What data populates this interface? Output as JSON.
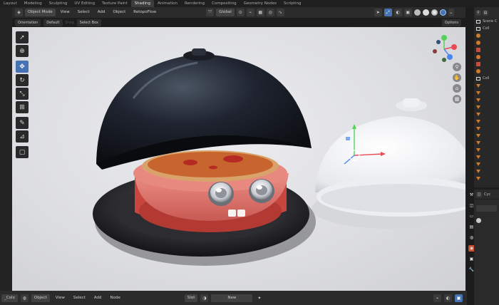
{
  "workspace_tabs": [
    {
      "label": "Layout",
      "active": false
    },
    {
      "label": "Modeling",
      "active": false
    },
    {
      "label": "Sculpting",
      "active": false
    },
    {
      "label": "UV Editing",
      "active": false
    },
    {
      "label": "Texture Paint",
      "active": false
    },
    {
      "label": "Shading",
      "active": true
    },
    {
      "label": "Animation",
      "active": false
    },
    {
      "label": "Rendering",
      "active": false
    },
    {
      "label": "Compositing",
      "active": false
    },
    {
      "label": "Geometry Nodes",
      "active": false
    },
    {
      "label": "Scripting",
      "active": false
    }
  ],
  "viewport_header": {
    "mode": "Object Mode",
    "menus": [
      "View",
      "Select",
      "Add",
      "Object"
    ],
    "addon": "RetopoFlow",
    "orientation": "Global",
    "icons": [
      "editor-type-icon",
      "transform-pivot-icon",
      "snap-icon",
      "proportional-icon"
    ]
  },
  "tool_settings": {
    "orientation_label": "Orientation",
    "orientation_value": "Default",
    "drag_label": "Drag",
    "drag_value": "Select Box",
    "options": "Options"
  },
  "toolbar": [
    {
      "icon": "select-cursor-icon",
      "active": false
    },
    {
      "icon": "cursor-3d-icon",
      "active": false
    },
    {
      "icon": "move-icon",
      "active": true
    },
    {
      "icon": "rotate-icon",
      "active": false
    },
    {
      "icon": "scale-icon",
      "active": false
    },
    {
      "icon": "transform-icon",
      "active": false
    },
    {
      "icon": "annotate-icon",
      "active": false
    },
    {
      "icon": "measure-icon",
      "active": false
    },
    {
      "icon": "add-cube-icon",
      "active": false
    }
  ],
  "outliner": {
    "header": "Scene C",
    "collection_1": "Coll",
    "collection_2": "Coll"
  },
  "bottom_header": {
    "editor_name": "_Colo",
    "object_select": "Object",
    "menus": [
      "View",
      "Select",
      "Add",
      "Node"
    ],
    "slot": "Slot",
    "new_button": "New"
  },
  "properties_header": "Cyc",
  "colors": {
    "accent_blue": "#4772b3",
    "plate": "#2a2a2e",
    "cloche_dark": "#1b1e24",
    "body_red": "#e27a70",
    "cloche_white": "#eef0f3"
  }
}
